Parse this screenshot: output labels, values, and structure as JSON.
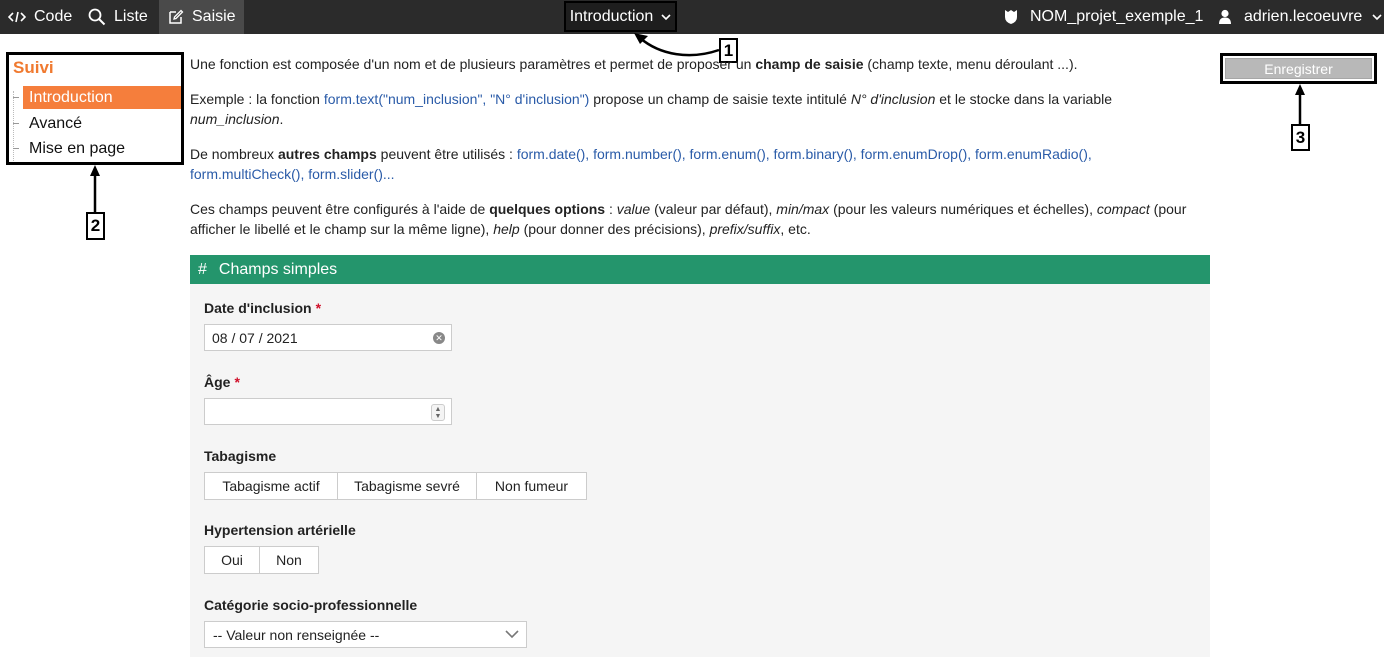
{
  "topbar": {
    "code_label": "Code",
    "liste_label": "Liste",
    "saisie_label": "Saisie",
    "page_select_label": "Introduction",
    "project_label": "NOM_projet_exemple_1",
    "user_label": "adrien.lecoeuvre"
  },
  "nav": {
    "title": "Suivi",
    "items": [
      {
        "label": "Introduction"
      },
      {
        "label": "Avancé"
      },
      {
        "label": "Mise en page"
      }
    ]
  },
  "callouts": {
    "one": "1",
    "two": "2",
    "three": "3"
  },
  "save_label": "Enregistrer",
  "content": {
    "p1_a": "Une fonction est composée d'un nom et de plusieurs paramètres et permet de proposer un ",
    "p1_b": "champ de saisie",
    "p1_c": " (champ texte, menu déroulant ...).",
    "p2_a": "Exemple : la fonction ",
    "p2_code": "form.text(\"num_inclusion\", \"N° d'inclusion\")",
    "p2_b": " propose un champ de saisie texte intitulé ",
    "p2_i1": "N° d'inclusion",
    "p2_c": " et le stocke dans la variable",
    "p2_i2": "num_inclusion",
    "p2_d": ".",
    "p3_a": "De nombreux ",
    "p3_b": "autres champs",
    "p3_c": " peuvent être utilisés : ",
    "p3_code1": "form.date(), form.number(), form.enum(), form.binary(), form.enumDrop(), form.enumRadio(),",
    "p3_code2": "form.multiCheck(), form.slider()...",
    "p4_a": "Ces champs peuvent être configurés à l'aide de ",
    "p4_b": "quelques options",
    "p4_c": " : ",
    "p4_i1": "value",
    "p4_d": " (valeur par défaut), ",
    "p4_i2": "min/max",
    "p4_e": " (pour les valeurs numériques et échelles), ",
    "p4_i3": "compact",
    "p4_f": " (pour",
    "p4_g": "afficher le libellé et le champ sur la même ligne), ",
    "p4_i4": "help",
    "p4_h": " (pour donner des précisions), ",
    "p4_i5": "prefix/suffix",
    "p4_j": ", etc."
  },
  "section": {
    "hash": "#",
    "title": "Champs simples"
  },
  "form": {
    "date_label": "Date d'inclusion",
    "date_value": "08 / 07 / 2021",
    "age_label": "Âge",
    "age_value": "",
    "required_mark": "*",
    "tabac_label": "Tabagisme",
    "tabac_options": [
      "Tabagisme actif",
      "Tabagisme sevré",
      "Non fumeur"
    ],
    "hta_label": "Hypertension artérielle",
    "hta_options": [
      "Oui",
      "Non"
    ],
    "csp_label": "Catégorie socio-professionnelle",
    "csp_value": "-- Valeur non renseignée --"
  },
  "icons": {
    "code": "code-icon",
    "search": "search-icon",
    "edit": "edit-icon",
    "chevron": "chevron-down-icon",
    "project": "shield-icon",
    "user": "user-icon"
  },
  "colors": {
    "topbar": "#2b2b2b",
    "accent": "#f57e3c",
    "section": "#24956c",
    "code_text": "#2a5ba8",
    "required": "#d0102a",
    "save_disabled": "#b8b8b8"
  }
}
